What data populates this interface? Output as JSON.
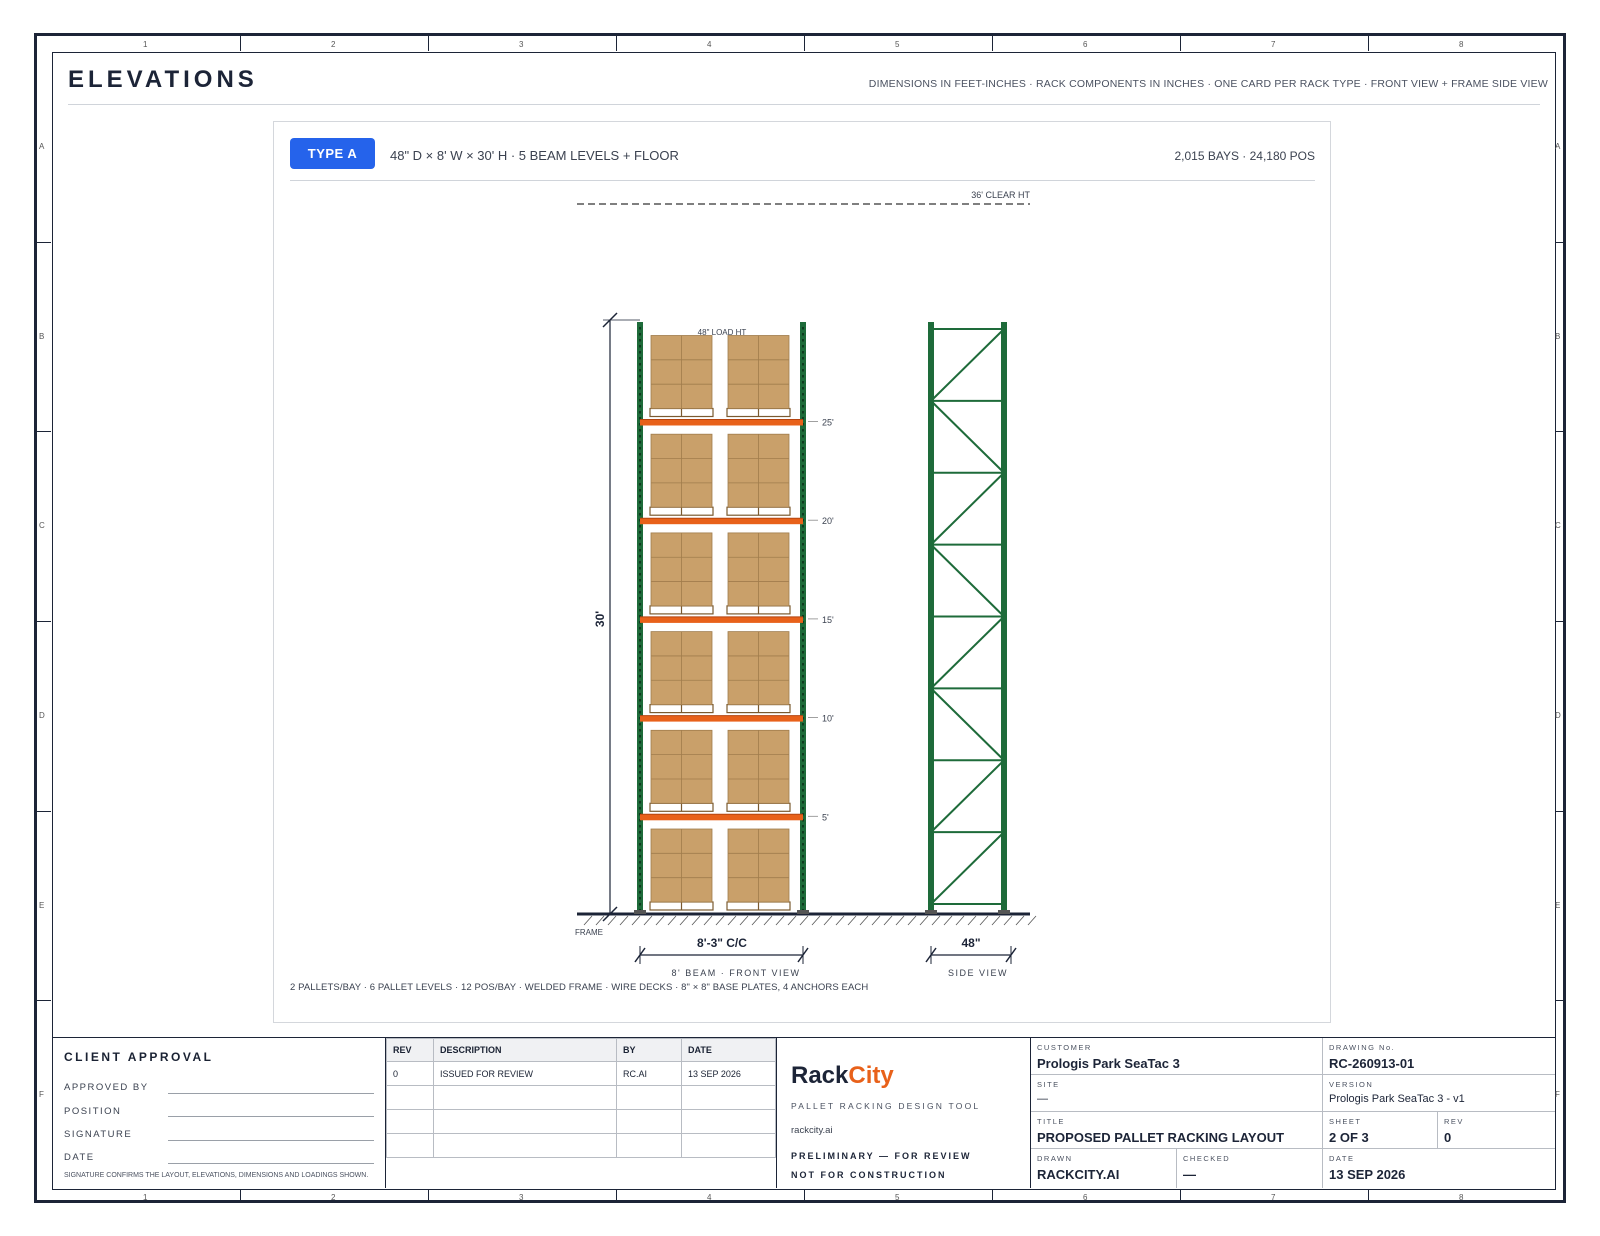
{
  "header": {
    "title": "ELEVATIONS",
    "subtitle": "DIMENSIONS IN FEET-INCHES · RACK COMPONENTS IN INCHES · ONE CARD PER RACK TYPE · FRONT VIEW + FRAME SIDE VIEW"
  },
  "grid": {
    "columns": [
      "1",
      "2",
      "3",
      "4",
      "5",
      "6",
      "7",
      "8"
    ],
    "rows": [
      "A",
      "B",
      "C",
      "D",
      "E",
      "F"
    ]
  },
  "card": {
    "badge": "TYPE A",
    "spec": "48\" D × 8' W × 30' H · 5 BEAM LEVELS + FLOOR",
    "bays": "2,015 BAYS · 24,180 POS",
    "clear_height": "36' CLEAR HT",
    "load_height": "48\" LOAD HT",
    "height_dim": "30'",
    "beam_levels": [
      "25'",
      "20'",
      "15'",
      "10'",
      "5'"
    ],
    "frame_label": "FRAME",
    "width_dim": "8'-3\" C/C",
    "front_caption": "8' BEAM · FRONT VIEW",
    "depth_dim": "48\"",
    "side_caption": "SIDE VIEW",
    "notes": "2 PALLETS/BAY · 6 PALLET LEVELS · 12 POS/BAY · WELDED FRAME · WIRE DECKS · 8\" × 8\" BASE PLATES, 4 ANCHORS EACH"
  },
  "colors": {
    "upright": "#1e6b3a",
    "beam": "#e8611a",
    "carton": "#c9a06a",
    "badge": "#2563eb",
    "brand_accent": "#e8611a"
  },
  "approval": {
    "title": "CLIENT APPROVAL",
    "approved_by": "APPROVED BY",
    "position": "POSITION",
    "signature": "SIGNATURE",
    "date": "DATE",
    "note": "SIGNATURE CONFIRMS THE LAYOUT, ELEVATIONS, DIMENSIONS AND LOADINGS SHOWN."
  },
  "revisions": {
    "headers": [
      "REV",
      "DESCRIPTION",
      "BY",
      "DATE"
    ],
    "rows": [
      [
        "0",
        "ISSUED FOR REVIEW",
        "RC.AI",
        "13 SEP 2026"
      ]
    ]
  },
  "brand": {
    "name_a": "Rack",
    "name_b": "City",
    "tagline": "PALLET RACKING DESIGN TOOL",
    "url": "rackcity.ai",
    "preliminary": "PRELIMINARY — FOR REVIEW",
    "not_for": "NOT FOR CONSTRUCTION"
  },
  "info": {
    "customer_label": "CUSTOMER",
    "customer": "Prologis Park SeaTac 3",
    "drawing_no_label": "DRAWING No.",
    "drawing_no": "RC-260913-01",
    "site_label": "SITE",
    "site": "—",
    "version_label": "VERSION",
    "version": "Prologis Park SeaTac 3 - v1",
    "title_label": "TITLE",
    "title": "PROPOSED PALLET RACKING LAYOUT",
    "sheet_label": "SHEET",
    "sheet": "2 OF 3",
    "rev_label": "REV",
    "rev": "0",
    "drawn_label": "DRAWN",
    "drawn": "RACKCITY.AI",
    "checked_label": "CHECKED",
    "checked": "—",
    "date_label": "DATE",
    "date": "13 SEP 2026"
  }
}
